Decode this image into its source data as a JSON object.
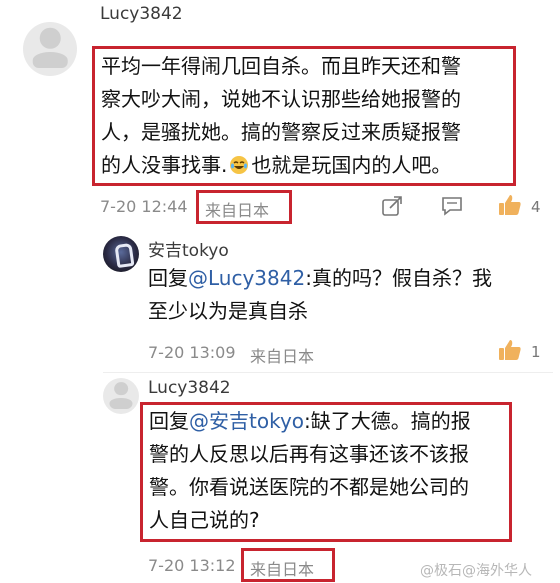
{
  "comments": [
    {
      "username": "Lucy3842",
      "text_lines": [
        "平均一年得闹几回自杀。而且昨天还和警",
        "察大吵大闹，说她不认识那些给她报警的",
        "人，是骚扰她。搞的警察反过来质疑报警",
        "的人没事找事."
      ],
      "emoji": "laugh-cry-emoji",
      "text_tail": "也就是玩国内的人吧。",
      "time": "7-20 12:44",
      "location": "来自日本",
      "likes": "4"
    },
    {
      "username": "安吉tokyo",
      "reply_prefix": "回复",
      "mention": "@Lucy3842",
      "text_first": ":真的吗？假自杀？我",
      "text_second": "至少以为是真自杀",
      "time": "7-20 13:09",
      "location": "来自日本",
      "likes": "1"
    },
    {
      "username": "Lucy3842",
      "reply_prefix": "回复",
      "mention": "@安吉tokyo",
      "text_first": ":缺了大德。搞的报",
      "text_lines": [
        "警的人反思以后再有这事还该不该报",
        "警。你看说送医院的不都是她公司的",
        "人自己说的?"
      ],
      "time": "7-20 13:12",
      "location": "来自日本"
    }
  ],
  "watermark": "@极石@海外华人",
  "colors": {
    "highlight_box": "#c8242f",
    "mention": "#2f5fa5",
    "like_icon": "#f0b15c"
  },
  "icons": [
    "share-icon",
    "comment-icon",
    "thumb-up-icon",
    "laugh-cry-emoji"
  ]
}
